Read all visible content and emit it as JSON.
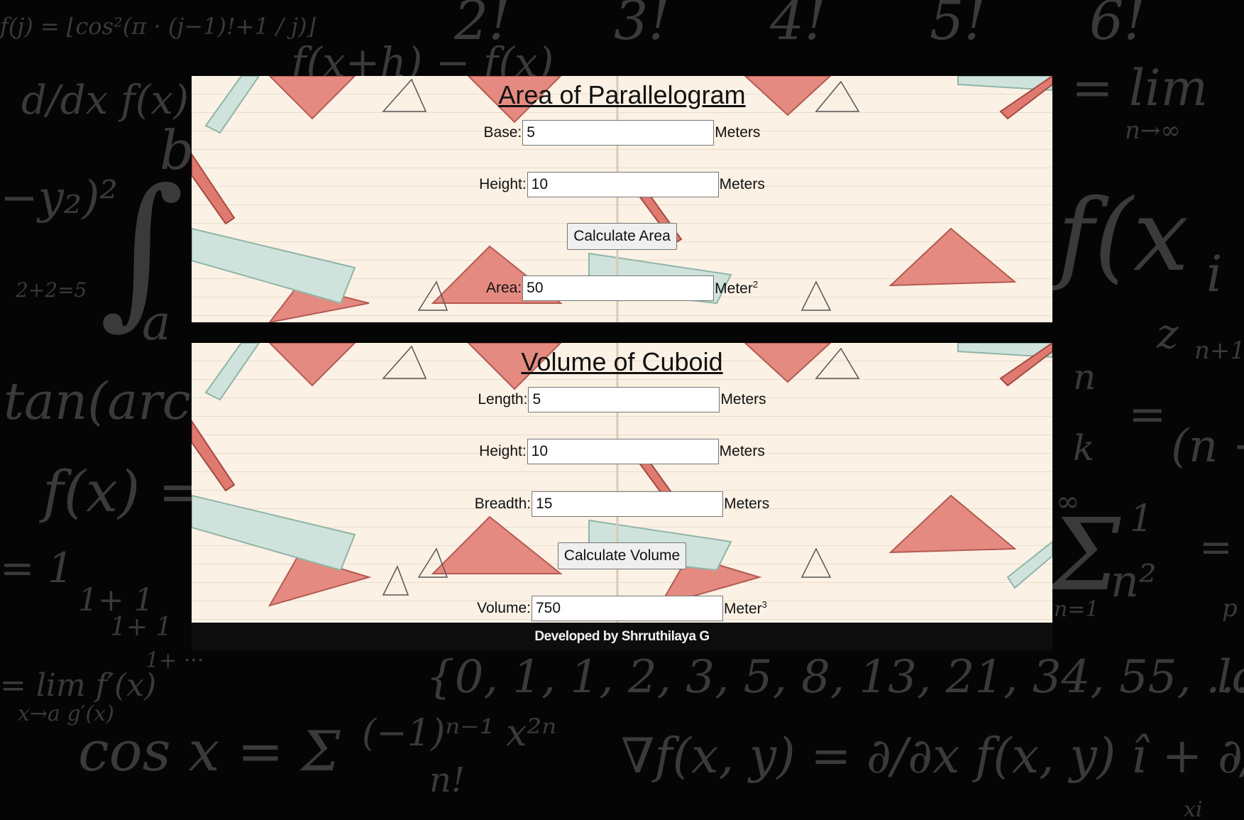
{
  "backdrop": {
    "formulas": [
      "f(j) = ⌊cos²(π · (j−1)!+1 / j)⌋",
      "2!",
      "3!",
      "4!",
      "5!",
      "6!",
      "f(x+h) − f(x)",
      "d/dx f(x) =",
      "= lim",
      "n→∞",
      "−y₂)²",
      "∫",
      "b",
      "a",
      "2+2=5",
      "f(x",
      "i",
      "tan(arcta",
      "z",
      "n+1",
      "n",
      "k",
      "=",
      "(n −",
      "f(x) =",
      "∞",
      "Σ",
      "1",
      "n²",
      "n=1",
      "=",
      "p",
      "= 1",
      "1+ 1",
      "1+ 1",
      "1+ ···",
      "= lim f′(x)",
      "x→a g′(x)",
      "{0, 1, 1, 2, 3, 5, 8, 13, 21, 34, 55, ...}",
      "lo",
      "cos x = Σ",
      "(−1)ⁿ⁻¹ x²ⁿ",
      "n!",
      "∇f(x, y) = ∂/∂x f(x, y) î + ∂/∂y f(x,",
      "xi"
    ]
  },
  "area_calc": {
    "title": "Area of Parallelogram",
    "base_label": "Base:",
    "base_value": "5",
    "base_unit": "Meters",
    "height_label": "Height:",
    "height_value": "10",
    "height_unit": "Meters",
    "button_label": "Calculate Area",
    "result_label": "Area:",
    "result_value": "50",
    "result_unit": "Meter",
    "result_unit_exponent": "2"
  },
  "volume_calc": {
    "title": "Volume of Cuboid",
    "length_label": "Length:",
    "length_value": "5",
    "length_unit": "Meters",
    "height_label": "Height:",
    "height_value": "10",
    "height_unit": "Meters",
    "breadth_label": "Breadth:",
    "breadth_value": "15",
    "breadth_unit": "Meters",
    "button_label": "Calculate Volume",
    "result_label": "Volume:",
    "result_value": "750",
    "result_unit": "Meter",
    "result_unit_exponent": "3"
  },
  "footer": {
    "credit": "Developed by Shrruthilaya G"
  },
  "colors": {
    "page_background": "#050505",
    "panel_background": "#fbf1e4",
    "triangle_red": "#e58a80",
    "ruler_mint": "#cfe3dc",
    "pencil_red": "#e07a70",
    "footer_background": "#0d0d0d"
  },
  "icons": [
    "triangle-ruler-illustration",
    "ruler-illustration",
    "pencil-illustration",
    "compass-illustration",
    "geometry-sketch-illustration"
  ]
}
